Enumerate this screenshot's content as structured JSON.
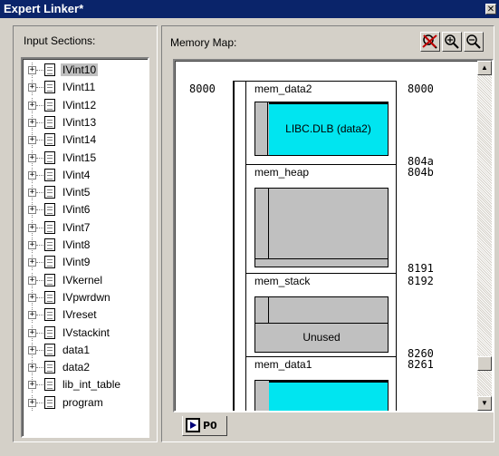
{
  "window": {
    "title": "Expert Linker*",
    "close_glyph": "✕"
  },
  "left": {
    "label": "Input Sections:",
    "items": [
      {
        "label": "IVint10",
        "selected": true
      },
      {
        "label": "IVint11"
      },
      {
        "label": "IVint12"
      },
      {
        "label": "IVint13"
      },
      {
        "label": "IVint14"
      },
      {
        "label": "IVint15"
      },
      {
        "label": "IVint4"
      },
      {
        "label": "IVint5"
      },
      {
        "label": "IVint6"
      },
      {
        "label": "IVint7"
      },
      {
        "label": "IVint8"
      },
      {
        "label": "IVint9"
      },
      {
        "label": "IVkernel"
      },
      {
        "label": "IVpwrdwn"
      },
      {
        "label": "IVreset"
      },
      {
        "label": "IVstackint"
      },
      {
        "label": "data1"
      },
      {
        "label": "data2"
      },
      {
        "label": "lib_int_table"
      },
      {
        "label": "program"
      }
    ],
    "expander_glyph": "+"
  },
  "right": {
    "label": "Memory Map:",
    "tools": [
      "view-mode-icon",
      "zoom-in-icon",
      "zoom-out-icon"
    ],
    "start_address": "8000",
    "segments": {
      "mem_data2": {
        "name": "mem_data2",
        "start": "8000",
        "end": "804a",
        "content": "LIBC.DLB (data2)"
      },
      "mem_heap": {
        "name": "mem_heap",
        "start": "804b",
        "end": "8191"
      },
      "mem_stack": {
        "name": "mem_stack",
        "start": "8192",
        "end": "8260",
        "unused": "Unused"
      },
      "mem_data1": {
        "name": "mem_data1",
        "start": "8261"
      }
    },
    "tab": {
      "label": "P0"
    }
  },
  "colors": {
    "accent_cyan": "#00e5f0",
    "titlebar": "#0a246a"
  }
}
